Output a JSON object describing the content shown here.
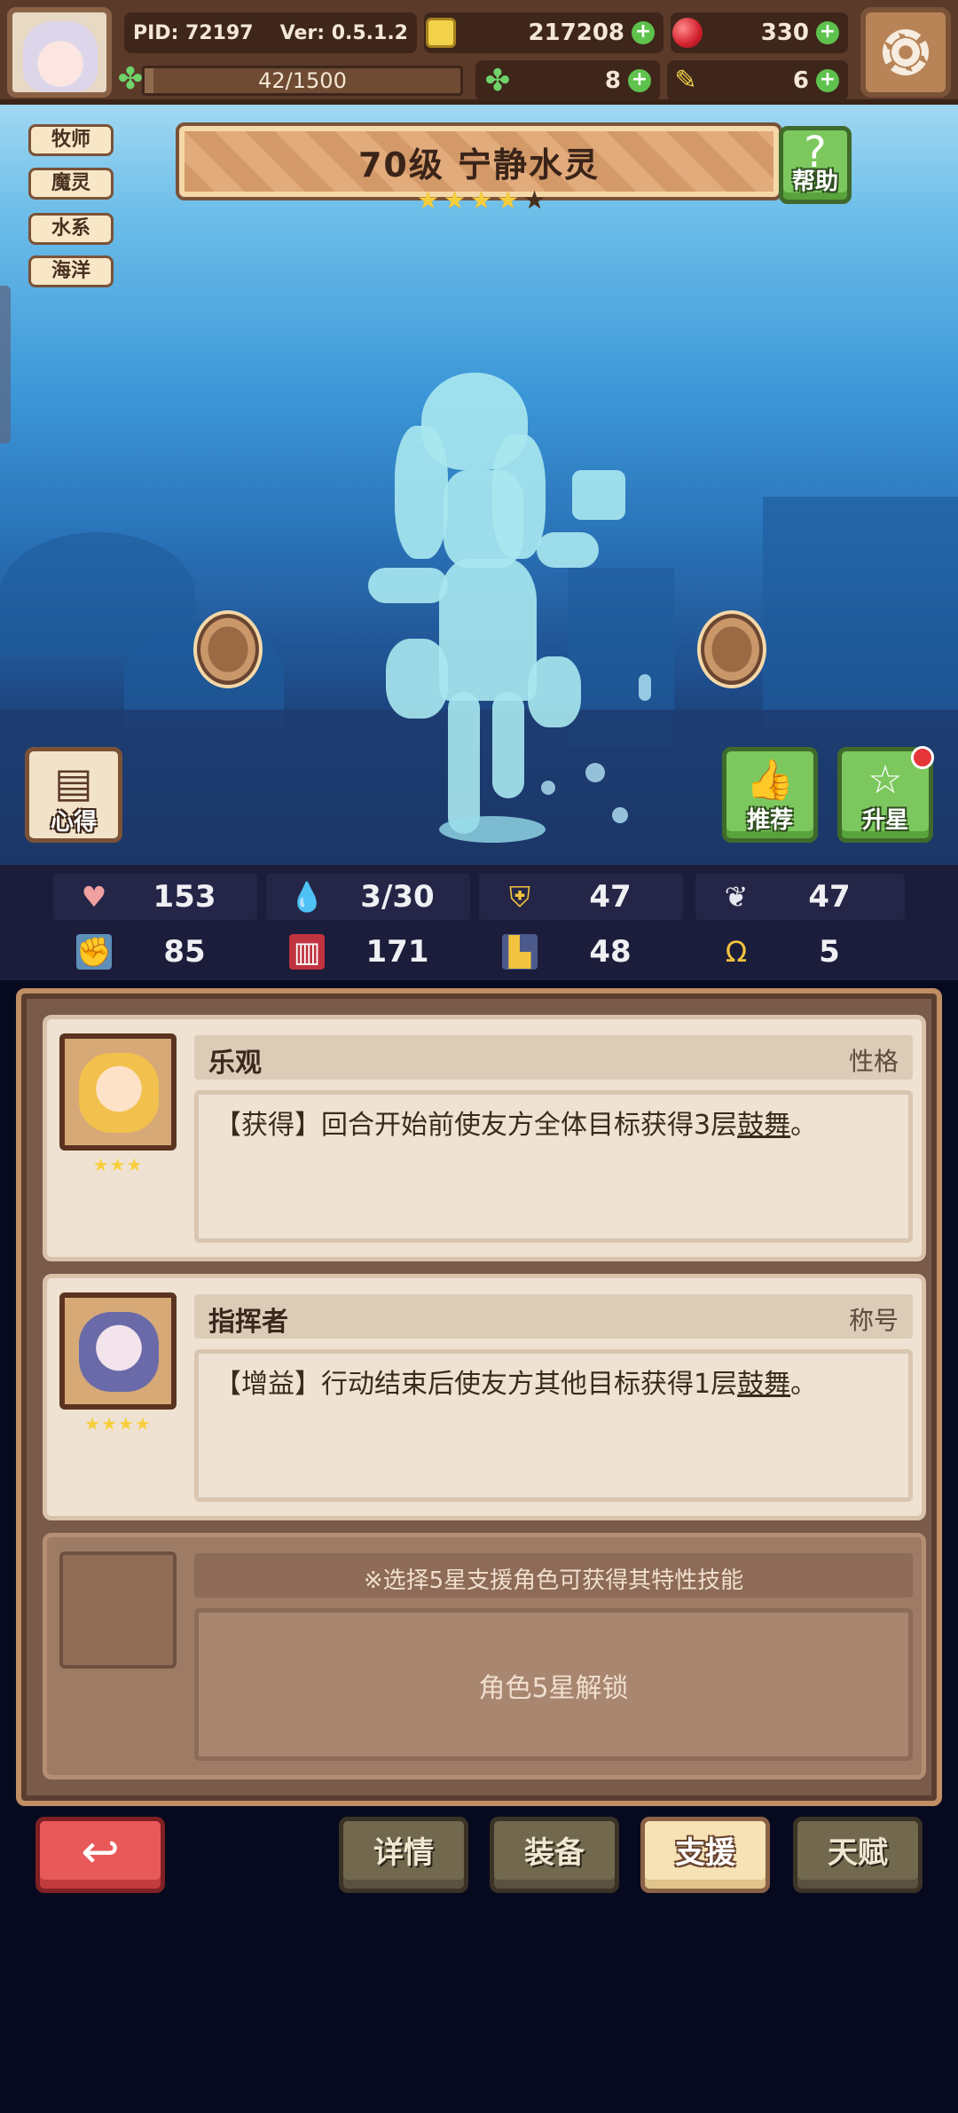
{
  "topbar": {
    "pid": "PID: 72197",
    "version": "Ver: 0.5.1.2",
    "gold": "217208",
    "gems": "330",
    "xp_text": "42/1500",
    "xp_fraction": 0.028,
    "clover": "8",
    "ticket": "6",
    "plus": "+"
  },
  "tags": [
    "牧师",
    "魔灵",
    "水系",
    "海洋"
  ],
  "hero": {
    "title": "70级  宁静水灵",
    "stars_filled": 4,
    "stars_total": 5
  },
  "buttons": {
    "help": "帮助",
    "help_glyph": "?",
    "insight": "心得",
    "recommend": "推荐",
    "upgrade_star": "升星"
  },
  "stats": [
    {
      "icon": "heart-icon",
      "value": "153"
    },
    {
      "icon": "water-drop-icon",
      "value": "3/30"
    },
    {
      "icon": "shield-icon",
      "value": "47"
    },
    {
      "icon": "wing-icon",
      "value": "47"
    },
    {
      "icon": "fist-icon",
      "value": "85"
    },
    {
      "icon": "book-icon",
      "value": "171"
    },
    {
      "icon": "stairs-icon",
      "value": "48"
    },
    {
      "icon": "horseshoe-icon",
      "value": "5"
    }
  ],
  "support": {
    "cards": [
      {
        "name": "乐观",
        "type": "性格",
        "desc_prefix": "【获得】回合开始前使友方全体目标获得3层",
        "keyword": "鼓舞",
        "desc_suffix": "。",
        "stars": "★★★"
      },
      {
        "name": "指挥者",
        "type": "称号",
        "desc_prefix": "【增益】行动结束后使友方其他目标获得1层",
        "keyword": "鼓舞",
        "desc_suffix": "。",
        "stars": "★★★★"
      }
    ],
    "locked_note": "※选择5星支援角色可获得其特性技能",
    "locked_text": "角色5星解锁"
  },
  "bottom": {
    "back_glyph": "↩",
    "tabs": [
      "详情",
      "装备",
      "支援",
      "天赋"
    ],
    "active_tab": "支援"
  },
  "colors": {
    "accent_green": "#7cc85e",
    "back_red": "#e8595a",
    "panel_brown": "#7a5a48",
    "star_gold": "#f7cf3c"
  }
}
